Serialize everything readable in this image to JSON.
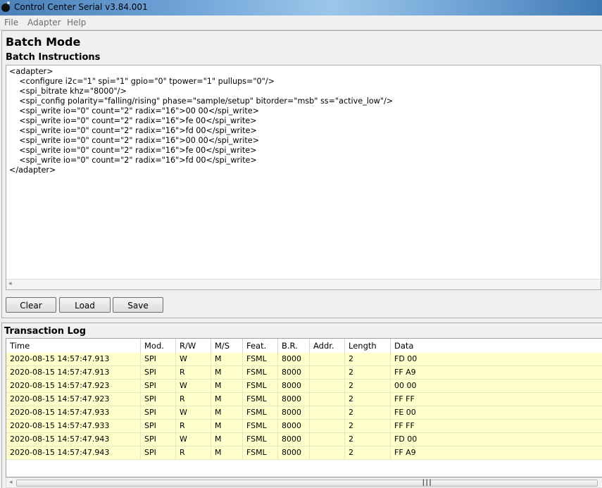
{
  "window": {
    "title": "Control Center Serial v3.84.001"
  },
  "menu": {
    "items": [
      "File",
      "Adapter",
      "Help"
    ]
  },
  "page_title": "Batch Mode",
  "batch": {
    "section_title": "Batch Instructions",
    "script": "<adapter>\n    <configure i2c=\"1\" spi=\"1\" gpio=\"0\" tpower=\"1\" pullups=\"0\"/>\n    <spi_bitrate khz=\"8000\"/>\n    <spi_config polarity=\"falling/rising\" phase=\"sample/setup\" bitorder=\"msb\" ss=\"active_low\"/>\n    <spi_write io=\"0\" count=\"2\" radix=\"16\">00 00</spi_write>\n    <spi_write io=\"0\" count=\"2\" radix=\"16\">fe 00</spi_write>\n    <spi_write io=\"0\" count=\"2\" radix=\"16\">fd 00</spi_write>\n    <spi_write io=\"0\" count=\"2\" radix=\"16\">00 00</spi_write>\n    <spi_write io=\"0\" count=\"2\" radix=\"16\">fe 00</spi_write>\n    <spi_write io=\"0\" count=\"2\" radix=\"16\">fd 00</spi_write>\n</adapter>",
    "buttons": {
      "clear": "Clear",
      "load": "Load",
      "save": "Save"
    }
  },
  "log": {
    "section_title": "Transaction Log",
    "columns": [
      "Time",
      "Mod.",
      "R/W",
      "M/S",
      "Feat.",
      "B.R.",
      "Addr.",
      "Length",
      "Data"
    ],
    "rows": [
      [
        "2020-08-15 14:57:47.913",
        "SPI",
        "W",
        "M",
        "FSML",
        "8000",
        "",
        "2",
        "FD 00"
      ],
      [
        "2020-08-15 14:57:47.913",
        "SPI",
        "R",
        "M",
        "FSML",
        "8000",
        "",
        "2",
        "FF A9"
      ],
      [
        "2020-08-15 14:57:47.923",
        "SPI",
        "W",
        "M",
        "FSML",
        "8000",
        "",
        "2",
        "00 00"
      ],
      [
        "2020-08-15 14:57:47.923",
        "SPI",
        "R",
        "M",
        "FSML",
        "8000",
        "",
        "2",
        "FF FF"
      ],
      [
        "2020-08-15 14:57:47.933",
        "SPI",
        "W",
        "M",
        "FSML",
        "8000",
        "",
        "2",
        "FE 00"
      ],
      [
        "2020-08-15 14:57:47.933",
        "SPI",
        "R",
        "M",
        "FSML",
        "8000",
        "",
        "2",
        "FF FF"
      ],
      [
        "2020-08-15 14:57:47.943",
        "SPI",
        "W",
        "M",
        "FSML",
        "8000",
        "",
        "2",
        "FD 00"
      ],
      [
        "2020-08-15 14:57:47.943",
        "SPI",
        "R",
        "M",
        "FSML",
        "8000",
        "",
        "2",
        "FF A9"
      ]
    ]
  }
}
